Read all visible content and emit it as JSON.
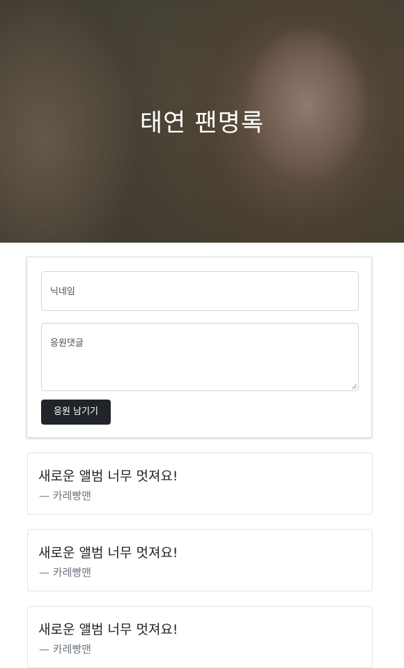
{
  "hero": {
    "title": "태연 팬명록"
  },
  "form": {
    "nickname_placeholder": "닉네임",
    "comment_placeholder": "응원댓글",
    "submit_label": "응원 남기기"
  },
  "comments": [
    {
      "text": "새로운 앨범 너무 멋져요!",
      "author": "— 카레빵맨"
    },
    {
      "text": "새로운 앨범 너무 멋져요!",
      "author": "— 카레빵맨"
    },
    {
      "text": "새로운 앨범 너무 멋져요!",
      "author": "— 카레빵맨"
    }
  ]
}
